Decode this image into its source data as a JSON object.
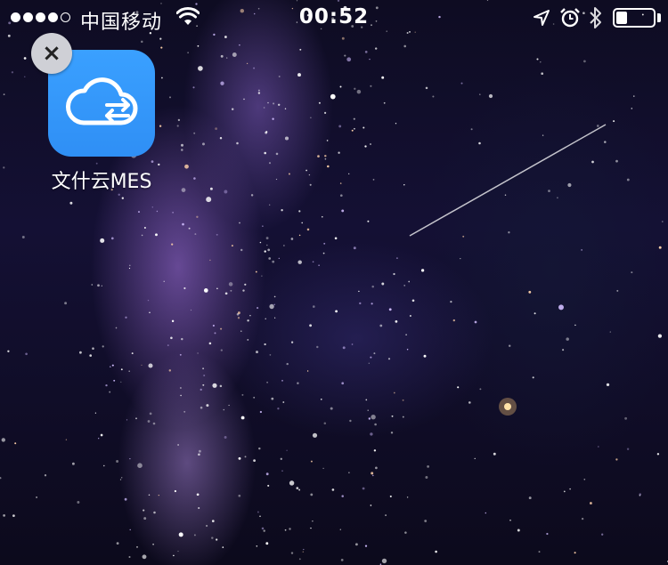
{
  "status_bar": {
    "signal_strength": 4,
    "signal_max": 5,
    "carrier": "中国移动",
    "time": "00:52",
    "battery_level": 0.3,
    "icons": [
      "signal-dots-icon",
      "wifi-icon",
      "location-arrow-icon",
      "alarm-clock-icon",
      "bluetooth-icon",
      "battery-icon"
    ]
  },
  "home_screen": {
    "apps": [
      {
        "label": "文什云MES",
        "icon": "cloud-sync-icon",
        "icon_color": "#3a9bff",
        "delete_badge": "×"
      }
    ]
  },
  "wallpaper": {
    "description_colors": [
      "#0e0c22",
      "#8a6ad8",
      "#c9b6f0"
    ]
  }
}
